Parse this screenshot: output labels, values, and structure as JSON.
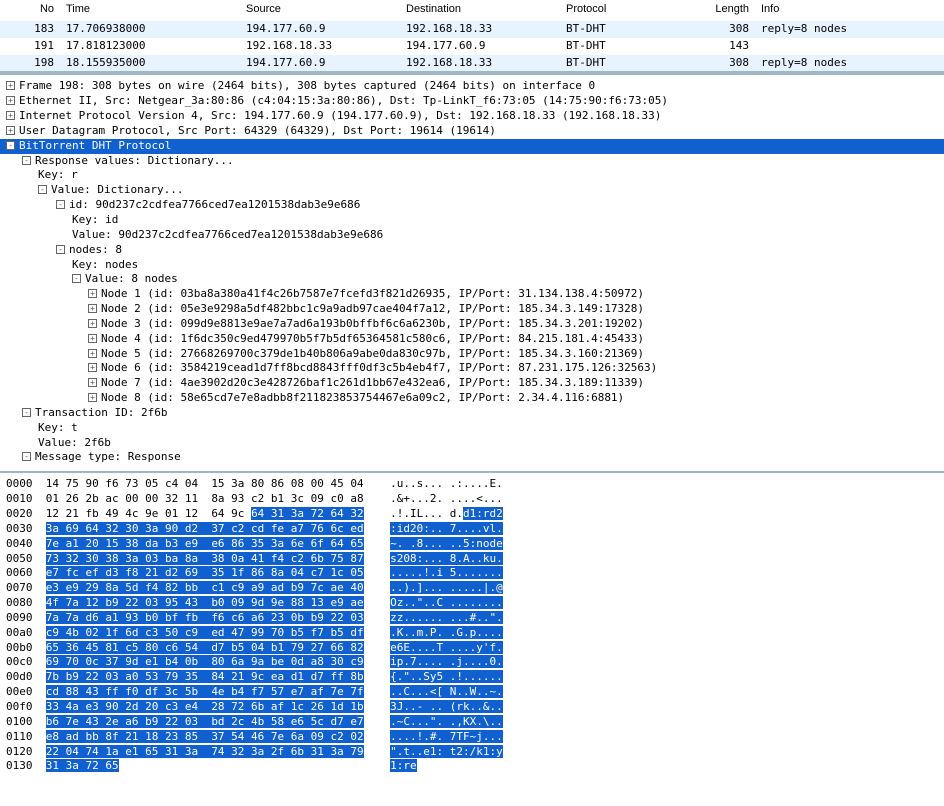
{
  "columns": {
    "no": "No",
    "time": "Time",
    "src": "Source",
    "dst": "Destination",
    "prot": "Protocol",
    "len": "Length",
    "info": "Info"
  },
  "rows": [
    {
      "no": "183",
      "time": "17.706938000",
      "src": "194.177.60.9",
      "dst": "192.168.18.33",
      "prot": "BT-DHT",
      "len": "308",
      "info": "reply=8 nodes"
    },
    {
      "no": "191",
      "time": "17.818123000",
      "src": "192.168.18.33",
      "dst": "194.177.60.9",
      "prot": "BT-DHT",
      "len": "143",
      "info": ""
    },
    {
      "no": "198",
      "time": "18.155935000",
      "src": "194.177.60.9",
      "dst": "192.168.18.33",
      "prot": "BT-DHT",
      "len": "308",
      "info": "reply=8 nodes"
    }
  ],
  "tree": {
    "frame": "Frame 198: 308 bytes on wire (2464 bits), 308 bytes captured (2464 bits) on interface 0",
    "eth": "Ethernet II, Src: Netgear_3a:80:86 (c4:04:15:3a:80:86), Dst: Tp-LinkT_f6:73:05 (14:75:90:f6:73:05)",
    "ip": "Internet Protocol Version 4, Src: 194.177.60.9 (194.177.60.9), Dst: 192.168.18.33 (192.168.18.33)",
    "udp": "User Datagram Protocol, Src Port: 64329 (64329), Dst Port: 19614 (19614)",
    "btdht": "BitTorrent DHT Protocol",
    "resp": "Response values: Dictionary...",
    "key_r": "Key: r",
    "val_dict": "Value: Dictionary...",
    "id_line": "id: 90d237c2cdfea7766ced7ea1201538dab3e9e686",
    "id_key": "Key: id",
    "id_val": "Value: 90d237c2cdfea7766ced7ea1201538dab3e9e686",
    "nodes8": "nodes: 8",
    "nodes_key": "Key: nodes",
    "nodes_val": "Value: 8 nodes",
    "n1": "Node 1 (id: 03ba8a380a41f4c26b7587e7fcefd3f821d26935, IP/Port: 31.134.138.4:50972)",
    "n2": "Node 2 (id: 05e3e9298a5df482bbc1c9a9adb97cae404f7a12, IP/Port: 185.34.3.149:17328)",
    "n3": "Node 3 (id: 099d9e8813e9ae7a7ad6a193b0bffbf6c6a6230b, IP/Port: 185.34.3.201:19202)",
    "n4": "Node 4 (id: 1f6dc350c9ed479970b5f7b5df65364581c580c6, IP/Port: 84.215.181.4:45433)",
    "n5": "Node 5 (id: 27668269700c379de1b40b806a9abe0da830c97b, IP/Port: 185.34.3.160:21369)",
    "n6": "Node 6 (id: 3584219cead1d7ff8bcd8843fff0df3c5b4eb4f7, IP/Port: 87.231.175.126:32563)",
    "n7": "Node 7 (id: 4ae3902d20c3e428726baf1c261d1bb67e432ea6, IP/Port: 185.34.3.189:11339)",
    "n8": "Node 8 (id: 58e65cd7e7e8adbb8f211823853754467e6a09c2, IP/Port: 2.34.4.116:6881)",
    "tid": "Transaction ID: 2f6b",
    "tkey": "Key: t",
    "tval": "Value: 2f6b",
    "mtype": "Message type: Response"
  },
  "hex": [
    {
      "off": "0000",
      "hn": "14 75 90 f6 73 05 c4 04  15 3a 80 86 08 00 45 04",
      "an": ".u..s... .:....E.",
      "hs": "",
      "as": ""
    },
    {
      "off": "0010",
      "hn": "01 26 2b ac 00 00 32 11  8a 93 c2 b1 3c 09 c0 a8",
      "an": ".&+...2. ....<...",
      "hs": "",
      "as": ""
    },
    {
      "off": "0020",
      "hn": "12 21 fb 49 4c 9e 01 12  64 9c ",
      "an": ".!.IL... d.",
      "hs": "64 31 3a 72 64 32",
      "as": "d1:rd2"
    },
    {
      "off": "0030",
      "hn": "",
      "an": "",
      "hs": "3a 69 64 32 30 3a 90 d2  37 c2 cd fe a7 76 6c ed",
      "as": ":id20:.. 7....vl."
    },
    {
      "off": "0040",
      "hn": "",
      "an": "",
      "hs": "7e a1 20 15 38 da b3 e9  e6 86 35 3a 6e 6f 64 65",
      "as": "~. .8... ..5:node"
    },
    {
      "off": "0050",
      "hn": "",
      "an": "",
      "hs": "73 32 30 38 3a 03 ba 8a  38 0a 41 f4 c2 6b 75 87",
      "as": "s208:... 8.A..ku."
    },
    {
      "off": "0060",
      "hn": "",
      "an": "",
      "hs": "e7 fc ef d3 f8 21 d2 69  35 1f 86 8a 04 c7 1c 05",
      "as": ".....!.i 5......."
    },
    {
      "off": "0070",
      "hn": "",
      "an": "",
      "hs": "e3 e9 29 8a 5d f4 82 bb  c1 c9 a9 ad b9 7c ae 40",
      "as": "..).]... .....|.@"
    },
    {
      "off": "0080",
      "hn": "",
      "an": "",
      "hs": "4f 7a 12 b9 22 03 95 43  b0 09 9d 9e 88 13 e9 ae",
      "as": "Oz..\"..C ........"
    },
    {
      "off": "0090",
      "hn": "",
      "an": "",
      "hs": "7a 7a d6 a1 93 b0 bf fb  f6 c6 a6 23 0b b9 22 03",
      "as": "zz...... ...#..\"."
    },
    {
      "off": "00a0",
      "hn": "",
      "an": "",
      "hs": "c9 4b 02 1f 6d c3 50 c9  ed 47 99 70 b5 f7 b5 df",
      "as": ".K..m.P. .G.p...."
    },
    {
      "off": "00b0",
      "hn": "",
      "an": "",
      "hs": "65 36 45 81 c5 80 c6 54  d7 b5 04 b1 79 27 66 82",
      "as": "e6E....T ....y'f."
    },
    {
      "off": "00c0",
      "hn": "",
      "an": "",
      "hs": "69 70 0c 37 9d e1 b4 0b  80 6a 9a be 0d a8 30 c9",
      "as": "ip.7.... .j....0."
    },
    {
      "off": "00d0",
      "hn": "",
      "an": "",
      "hs": "7b b9 22 03 a0 53 79 35  84 21 9c ea d1 d7 ff 8b",
      "as": "{.\"..Sy5 .!......"
    },
    {
      "off": "00e0",
      "hn": "",
      "an": "",
      "hs": "cd 88 43 ff f0 df 3c 5b  4e b4 f7 57 e7 af 7e 7f",
      "as": "..C...<[ N..W..~."
    },
    {
      "off": "00f0",
      "hn": "",
      "an": "",
      "hs": "33 4a e3 90 2d 20 c3 e4  28 72 6b af 1c 26 1d 1b",
      "as": "3J..- .. (rk..&.."
    },
    {
      "off": "0100",
      "hn": "",
      "an": "",
      "hs": "b6 7e 43 2e a6 b9 22 03  bd 2c 4b 58 e6 5c d7 e7",
      "as": ".~C...\". .,KX.\\.."
    },
    {
      "off": "0110",
      "hn": "",
      "an": "",
      "hs": "e8 ad bb 8f 21 18 23 85  37 54 46 7e 6a 09 c2 02",
      "as": "....!.#. 7TF~j..."
    },
    {
      "off": "0120",
      "hn": "",
      "an": "",
      "hs": "22 04 74 1a e1 65 31 3a  74 32 3a 2f 6b 31 3a 79",
      "as": "\".t..e1: t2:/k1:y"
    },
    {
      "off": "0130",
      "hn": "",
      "an": "",
      "hs": "31 3a 72 65",
      "as": "1:re"
    }
  ]
}
